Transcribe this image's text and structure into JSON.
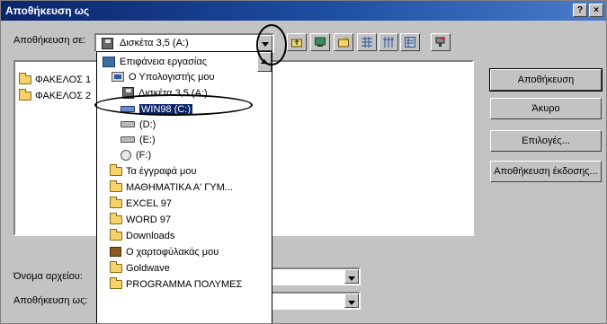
{
  "window": {
    "title": "Αποθήκευση ως",
    "help_label": "?",
    "close_label": "×"
  },
  "save_in": {
    "label": "Αποθήκευση σε:",
    "value": "Δισκέτα 3,5 (A:)"
  },
  "toolbar": {
    "icons": [
      "up-folder-icon",
      "desktop-icon",
      "new-folder-icon",
      "list-view-icon",
      "details-view-icon",
      "properties-view-icon",
      "tools-icon"
    ]
  },
  "files": [
    {
      "name": "ΦΑΚΕΛΟΣ 1",
      "icon": "folder-icon"
    },
    {
      "name": "ΦΑΚΕΛΟΣ 2",
      "icon": "folder-icon"
    }
  ],
  "dropdown": {
    "items": [
      {
        "label": "Επιφάνεια εργασίας",
        "icon": "desktop-icon",
        "level": 0
      },
      {
        "label": "Ο Υπολογιστής μου",
        "icon": "computer-icon",
        "level": 1
      },
      {
        "label": "Δισκέτα 3,5 (A:)",
        "icon": "floppy-icon",
        "level": 2
      },
      {
        "label": "WIN98 (C:)",
        "icon": "hard-drive-icon",
        "level": 2,
        "selected": true
      },
      {
        "label": "(D:)",
        "icon": "drive-icon",
        "level": 2
      },
      {
        "label": "(E:)",
        "icon": "drive-icon",
        "level": 2
      },
      {
        "label": "(F:)",
        "icon": "cd-drive-icon",
        "level": 2
      },
      {
        "label": "Τα έγγραφά μου",
        "icon": "folder-icon",
        "level": 1
      },
      {
        "label": "ΜΑΘΗΜΑΤΙΚΑ Α' ΓΥΜ...",
        "icon": "folder-icon",
        "level": 1
      },
      {
        "label": "EXCEL 97",
        "icon": "folder-icon",
        "level": 1
      },
      {
        "label": "WORD 97",
        "icon": "folder-icon",
        "level": 1
      },
      {
        "label": "Downloads",
        "icon": "folder-icon",
        "level": 1
      },
      {
        "label": "Ο χαρτοφύλακάς μου",
        "icon": "briefcase-icon",
        "level": 1
      },
      {
        "label": "Goldwave",
        "icon": "folder-icon",
        "level": 1
      },
      {
        "label": "PROGRAMMA ΠΟΛΥΜΕΣ",
        "icon": "folder-icon",
        "level": 1
      }
    ]
  },
  "buttons": {
    "save": "Αποθήκευση",
    "cancel": "Άκυρο",
    "options": "Επιλογές...",
    "save_version": "Αποθήκευση έκδοσης..."
  },
  "bottom": {
    "filename_label": "Όνομα αρχείου:",
    "savetype_label": "Αποθήκευση ως:"
  },
  "colors": {
    "title_bar": "#0a246a",
    "selection": "#0a246a",
    "dialog_face": "#c3c3c3"
  }
}
